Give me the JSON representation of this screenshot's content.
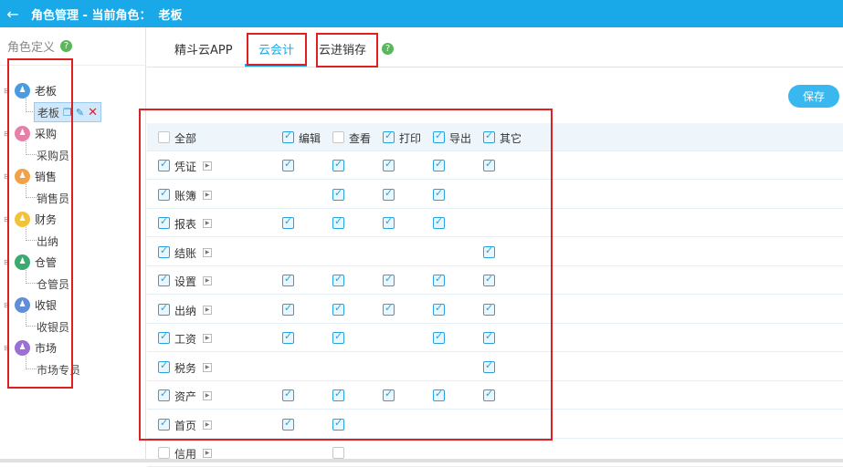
{
  "header": {
    "back": "←",
    "title": "角色管理 - 当前角色：",
    "current_role": "老板"
  },
  "sidebar": {
    "heading": "角色定义",
    "help": "?",
    "groups": [
      {
        "name": "老板",
        "child": "老板",
        "color": "#4a9be0"
      },
      {
        "name": "采购",
        "child": "采购员",
        "color": "#e87fa8"
      },
      {
        "name": "销售",
        "child": "销售员",
        "color": "#f0a24a"
      },
      {
        "name": "财务",
        "child": "出纳",
        "color": "#f2c23a"
      },
      {
        "name": "仓管",
        "child": "仓管员",
        "color": "#3aaa6e"
      },
      {
        "name": "收银",
        "child": "收银员",
        "color": "#5f8fd6"
      },
      {
        "name": "市场",
        "child": "市场专员",
        "color": "#9a6fd6"
      }
    ]
  },
  "tabs": [
    {
      "label": "精斗云APP"
    },
    {
      "label": "云会计"
    },
    {
      "label": "云进销存"
    }
  ],
  "save_label": "保存",
  "columns": [
    "全部",
    "编辑",
    "查看",
    "打印",
    "导出",
    "其它"
  ],
  "header_checks": [
    false,
    true,
    false,
    true,
    true,
    true
  ],
  "rows": [
    {
      "label": "凭证",
      "checked": true,
      "perms": [
        true,
        true,
        true,
        true,
        true
      ]
    },
    {
      "label": "账簿",
      "checked": true,
      "perms": [
        null,
        true,
        true,
        true,
        null
      ]
    },
    {
      "label": "报表",
      "checked": true,
      "perms": [
        true,
        true,
        true,
        true,
        null
      ]
    },
    {
      "label": "结账",
      "checked": true,
      "perms": [
        null,
        null,
        null,
        null,
        true
      ]
    },
    {
      "label": "设置",
      "checked": true,
      "perms": [
        true,
        true,
        true,
        true,
        true
      ]
    },
    {
      "label": "出纳",
      "checked": true,
      "perms": [
        true,
        true,
        true,
        true,
        true
      ]
    },
    {
      "label": "工资",
      "checked": true,
      "perms": [
        true,
        true,
        null,
        true,
        true
      ]
    },
    {
      "label": "税务",
      "checked": true,
      "perms": [
        null,
        null,
        null,
        null,
        true
      ]
    },
    {
      "label": "资产",
      "checked": true,
      "perms": [
        true,
        true,
        true,
        true,
        true
      ]
    },
    {
      "label": "首页",
      "checked": true,
      "perms": [
        true,
        true,
        null,
        null,
        null
      ]
    },
    {
      "label": "信用",
      "checked": false,
      "perms": [
        null,
        false,
        null,
        null,
        null
      ]
    }
  ]
}
